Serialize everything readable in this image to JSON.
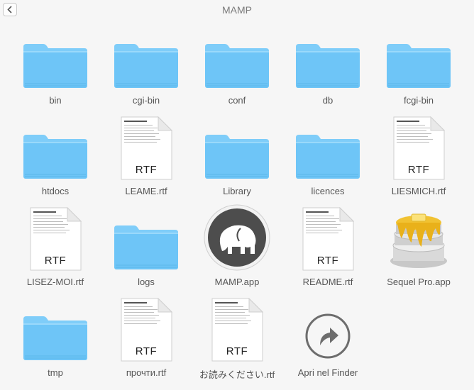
{
  "window": {
    "title": "MAMP"
  },
  "items": [
    {
      "label": "bin",
      "kind": "folder"
    },
    {
      "label": "cgi-bin",
      "kind": "folder"
    },
    {
      "label": "conf",
      "kind": "folder"
    },
    {
      "label": "db",
      "kind": "folder"
    },
    {
      "label": "fcgi-bin",
      "kind": "folder"
    },
    {
      "label": "htdocs",
      "kind": "folder"
    },
    {
      "label": "LEAME.rtf",
      "kind": "rtf",
      "tag": "RTF"
    },
    {
      "label": "Library",
      "kind": "folder"
    },
    {
      "label": "licences",
      "kind": "folder"
    },
    {
      "label": "LIESMICH.rtf",
      "kind": "rtf",
      "tag": "RTF"
    },
    {
      "label": "LISEZ-MOI.rtf",
      "kind": "rtf",
      "tag": "RTF"
    },
    {
      "label": "logs",
      "kind": "folder"
    },
    {
      "label": "MAMP.app",
      "kind": "app",
      "icon": "mamp-elephant-icon"
    },
    {
      "label": "README.rtf",
      "kind": "rtf",
      "tag": "RTF"
    },
    {
      "label": "Sequel Pro.app",
      "kind": "app",
      "icon": "sequel-pro-icon"
    },
    {
      "label": "tmp",
      "kind": "folder"
    },
    {
      "label": "прочти.rtf",
      "kind": "rtf",
      "tag": "RTF"
    },
    {
      "label": "お読みください.rtf",
      "kind": "rtf",
      "tag": "RTF"
    },
    {
      "label": "Apri nel Finder",
      "kind": "action",
      "icon": "open-in-finder-icon"
    }
  ],
  "colors": {
    "folder_top": "#8fd3fb",
    "folder_body": "#6cc4f7",
    "background": "#f6f6f6"
  }
}
